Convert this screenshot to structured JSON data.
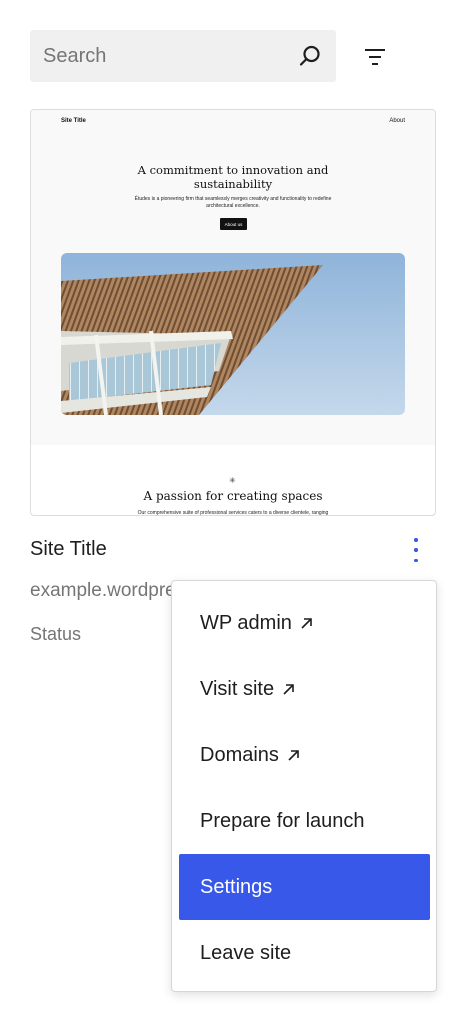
{
  "search": {
    "placeholder": "Search"
  },
  "preview": {
    "site_title": "Site Title",
    "nav_link": "About",
    "headline": "A commitment to innovation and sustainability",
    "description": "Études is a pioneering firm that seamlessly merges creativity and functionality to redefine architectural excellence.",
    "button_label": "About us",
    "section_mark": "✳",
    "section_title": "A passion for creating spaces",
    "section_sub": "Our comprehensive suite of professional services caters to a diverse clientele, ranging"
  },
  "site": {
    "name": "Site Title",
    "url": "example.wordpress.com",
    "status": "Status"
  },
  "menu": {
    "items": [
      {
        "label": "WP admin",
        "external": true
      },
      {
        "label": "Visit site",
        "external": true
      },
      {
        "label": "Domains",
        "external": true
      },
      {
        "label": "Prepare for launch",
        "external": false
      },
      {
        "label": "Settings",
        "external": false,
        "active": true
      },
      {
        "label": "Leave site",
        "external": false
      }
    ]
  },
  "colors": {
    "accent": "#3858e9",
    "muted_text": "#757575"
  }
}
